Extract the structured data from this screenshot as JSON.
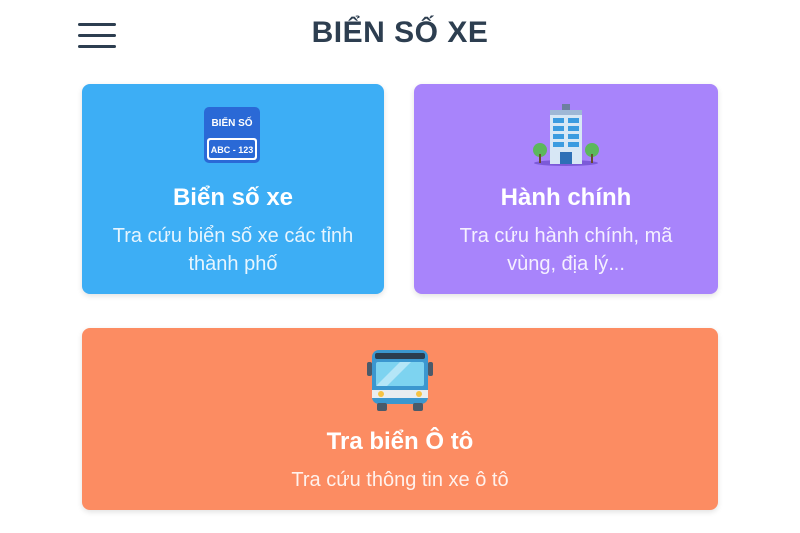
{
  "header": {
    "title": "BIỂN SỐ XE",
    "menu_icon": "hamburger-menu-icon"
  },
  "cards": [
    {
      "title": "Biển số xe",
      "description": "Tra cứu biển số xe các tỉnh thành phố",
      "icon": "license-plate-icon",
      "icon_text_top": "BIỂN SỐ",
      "icon_text_bottom": "ABC - 123",
      "color": "#3daef5"
    },
    {
      "title": "Hành chính",
      "description": "Tra cứu hành chính, mã vùng, địa lý...",
      "icon": "office-building-icon",
      "color": "#a884fb"
    },
    {
      "title": "Tra biển Ô tô",
      "description": "Tra cứu thông tin xe ô tô",
      "icon": "bus-icon",
      "color": "#fc8c62"
    }
  ]
}
